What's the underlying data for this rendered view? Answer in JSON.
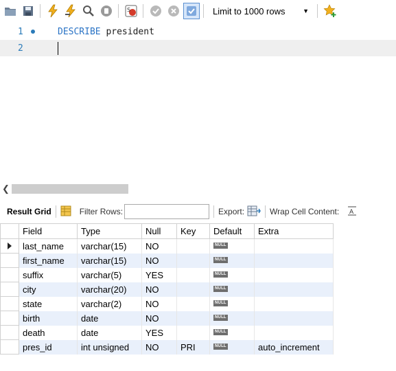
{
  "toolbar": {
    "limit_label": "Limit to 1000 rows",
    "icons": [
      "open-folder-icon",
      "save-icon",
      "execute-icon",
      "execute-current-icon",
      "explain-icon",
      "stop-icon",
      "toggle-error-icon",
      "commit-icon",
      "rollback-icon",
      "autocommit-icon",
      "favorite-add-icon"
    ]
  },
  "editor": {
    "lines": [
      {
        "number": "1",
        "keyword": "DESCRIBE",
        "text": " president"
      },
      {
        "number": "2",
        "keyword": "",
        "text": ""
      }
    ]
  },
  "result_toolbar": {
    "tab_label": "Result Grid",
    "filter_label": "Filter Rows:",
    "filter_value": "",
    "export_label": "Export:",
    "wrap_label": "Wrap Cell Content:"
  },
  "grid": {
    "columns": [
      "Field",
      "Type",
      "Null",
      "Key",
      "Default",
      "Extra"
    ],
    "null_badge": "NULL",
    "rows": [
      {
        "field": "last_name",
        "type": "varchar(15)",
        "null": "NO",
        "key": "",
        "default": "NULL",
        "extra": ""
      },
      {
        "field": "first_name",
        "type": "varchar(15)",
        "null": "NO",
        "key": "",
        "default": "NULL",
        "extra": ""
      },
      {
        "field": "suffix",
        "type": "varchar(5)",
        "null": "YES",
        "key": "",
        "default": "NULL",
        "extra": ""
      },
      {
        "field": "city",
        "type": "varchar(20)",
        "null": "NO",
        "key": "",
        "default": "NULL",
        "extra": ""
      },
      {
        "field": "state",
        "type": "varchar(2)",
        "null": "NO",
        "key": "",
        "default": "NULL",
        "extra": ""
      },
      {
        "field": "birth",
        "type": "date",
        "null": "NO",
        "key": "",
        "default": "NULL",
        "extra": ""
      },
      {
        "field": "death",
        "type": "date",
        "null": "YES",
        "key": "",
        "default": "NULL",
        "extra": ""
      },
      {
        "field": "pres_id",
        "type": "int unsigned",
        "null": "NO",
        "key": "PRI",
        "default": "NULL",
        "extra": "auto_increment"
      }
    ]
  },
  "colors": {
    "accent": "#2b7bb9",
    "keyword": "#2a73c5",
    "row_alt": "#e9f0fb"
  }
}
